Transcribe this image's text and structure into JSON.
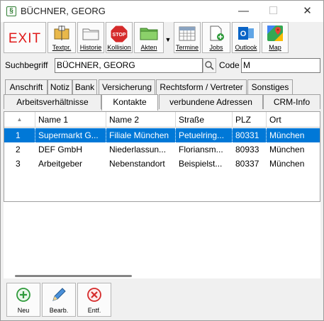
{
  "window": {
    "title": "BÜCHNER, GEORG",
    "app_icon_glyph": "§",
    "minimize_glyph": "—",
    "maximize_glyph": "☐",
    "close_glyph": "✕"
  },
  "toolbar": {
    "exit_label": "EXIT",
    "buttons": [
      {
        "label": "Textpr.",
        "icon": "text-processor-icon"
      },
      {
        "label": "Historie",
        "icon": "folder-history-icon"
      },
      {
        "label": "Kollision",
        "icon": "stop-sign-icon"
      },
      {
        "label": "Akten",
        "icon": "green-folder-icon"
      },
      {
        "label": "Termine",
        "icon": "calendar-icon"
      },
      {
        "label": "Jobs",
        "icon": "document-add-icon"
      },
      {
        "label": "Outlook",
        "icon": "outlook-icon"
      },
      {
        "label": "Map",
        "icon": "google-maps-icon"
      }
    ]
  },
  "search": {
    "label": "Suchbegriff",
    "value": "BÜCHNER, GEORG",
    "code_label": "Code",
    "code_value": "M"
  },
  "tabs_row1": [
    "Anschrift",
    "Notiz",
    "Bank",
    "Versicherung",
    "Rechtsform / Vertreter",
    "Sonstiges"
  ],
  "tabs_row2": [
    "Arbeitsverhältnisse",
    "Kontakte",
    "verbundene Adressen",
    "CRM-Info"
  ],
  "table": {
    "sort_glyph": "▲",
    "columns": [
      "Name 1",
      "Name 2",
      "Straße",
      "PLZ",
      "Ort"
    ],
    "rows": [
      {
        "num": "1",
        "name1": "Supermarkt G...",
        "name2": "Filiale München",
        "strasse": "Petuelring...",
        "plz": "80331",
        "ort": "München",
        "selected": true
      },
      {
        "num": "2",
        "name1": "DEF GmbH",
        "name2": "Niederlassun...",
        "strasse": "Floriansm...",
        "plz": "80933",
        "ort": "München",
        "selected": false
      },
      {
        "num": "3",
        "name1": "Arbeitgeber",
        "name2": "Nebenstandort",
        "strasse": "Beispielst...",
        "plz": "80337",
        "ort": "München",
        "selected": false
      }
    ]
  },
  "bottom": {
    "new_label": "Neu",
    "edit_label": "Bearb.",
    "delete_label": "Entf."
  },
  "colors": {
    "selection": "#0078d7",
    "exit_red": "#e01b1b",
    "add_green": "#2e9a3a",
    "delete_red": "#d52b2b"
  }
}
